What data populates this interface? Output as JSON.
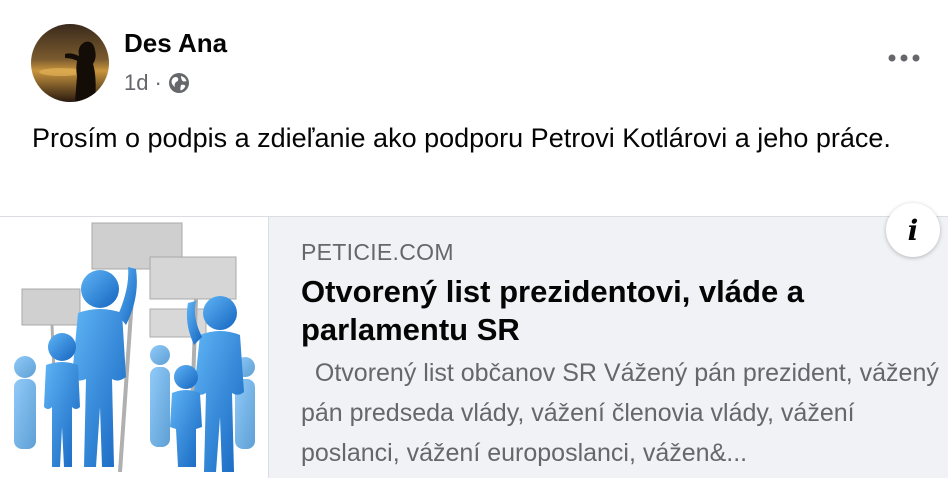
{
  "post": {
    "author": "Des Ana",
    "time": "1d",
    "separator": "·",
    "audience_icon": "globe-icon",
    "more_icon": "more-options-icon",
    "message": "Prosím o podpis a zdieľanie ako podporu Petrovi Kotlárovi a jeho práce."
  },
  "link": {
    "domain": "PETICIE.COM",
    "title": "Otvorený list prezidentovi, vláde a parlamentu SR",
    "description": "  Otvorený list občanov SR Vážený pán prezident, vážený pán predseda vlády, vážení členovia vlády, vážení poslanci, vážení europoslanci, vážen&...",
    "info_icon": "i"
  },
  "colors": {
    "text": "#050505",
    "secondary": "#65676b",
    "card_bg": "#f0f2f5",
    "figure_blue": "#1e88e5"
  }
}
